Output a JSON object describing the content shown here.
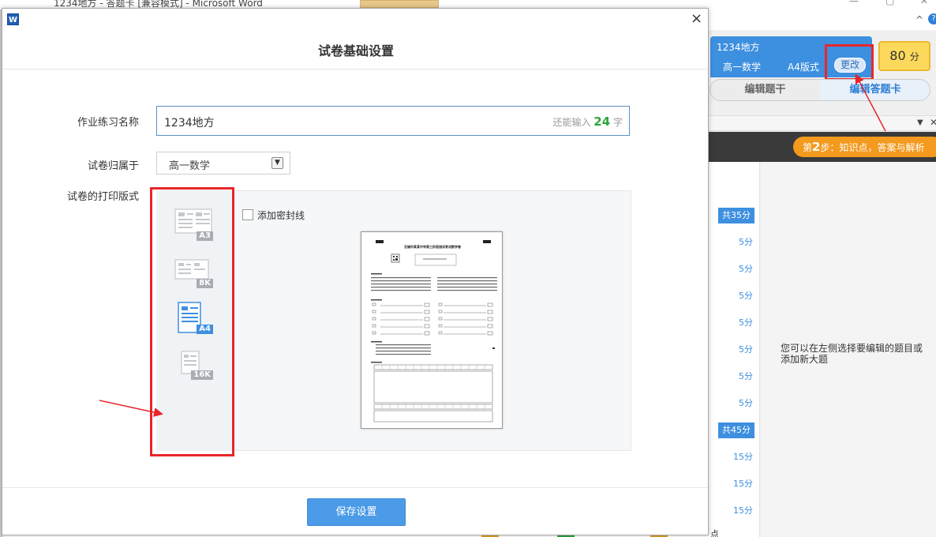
{
  "word": {
    "title": "1234地方 - 答题卡 [兼容模式] - Microsoft Word",
    "help_symbol": "^",
    "help_q": "?"
  },
  "dialog": {
    "title": "试卷基础设置",
    "close_symbol": "×",
    "app_icon": "W",
    "name_label": "作业练习名称",
    "name_value": "1234地方",
    "name_remaining_prefix": "还能输入",
    "name_remaining_count": "24",
    "name_remaining_suffix": "字",
    "subject_label": "试卷归属于",
    "subject_value": "高一数学",
    "layout_label": "试卷的打印版式",
    "formats": [
      "A3",
      "8K",
      "A4",
      "16K"
    ],
    "selected_format": "A4",
    "seal_line_label": "添加密封线",
    "seal_line_checked": false,
    "save_button": "保存设置",
    "preview_heading": "无锡市某某中学高三阶段测试考试数学卷"
  },
  "side_panel": {
    "paper_name": "1234地方",
    "subject": "高一数学",
    "format": "A4版式",
    "change_button": "更改",
    "score": "80",
    "score_unit": "分",
    "tab_left": "编辑题干",
    "tab_right": "编辑答题卡",
    "step_prefix": "第",
    "step_number": "2",
    "step_suffix": "步",
    "step_text": "知识点，答案与解析",
    "hint": "您可以在左侧选择要编辑的题目或添加新大题",
    "scores": [
      {
        "label": "共35分",
        "total": true
      },
      {
        "label": "5分",
        "total": false
      },
      {
        "label": "5分",
        "total": false
      },
      {
        "label": "5分",
        "total": false
      },
      {
        "label": "5分",
        "total": false
      },
      {
        "label": "5分",
        "total": false
      },
      {
        "label": "5分",
        "total": false
      },
      {
        "label": "5分",
        "total": false
      },
      {
        "label": "共45分",
        "total": true
      },
      {
        "label": "15分",
        "total": false
      },
      {
        "label": "15分",
        "total": false
      },
      {
        "label": "15分",
        "total": false
      }
    ],
    "bottom_text": "点"
  },
  "colors": {
    "accent": "#3d8fe0",
    "highlight_red": "#e8262a",
    "step_orange": "#f39a1f",
    "score_yellow": "#fcd95b"
  }
}
